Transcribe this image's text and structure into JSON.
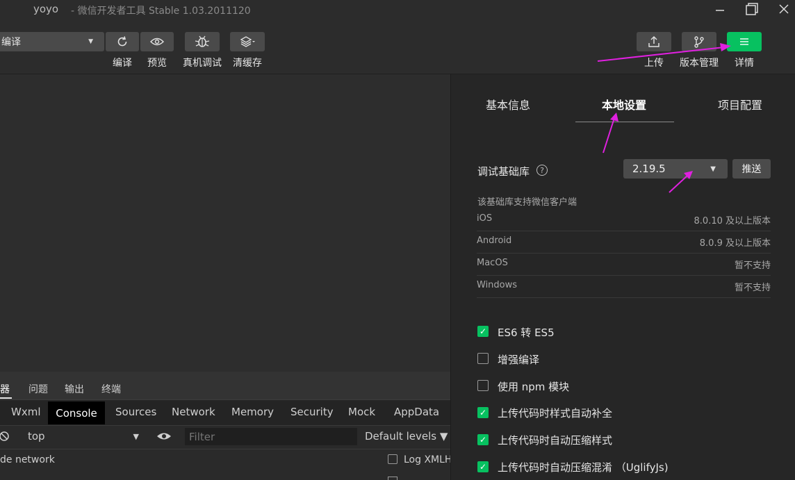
{
  "titlebar": {
    "project_name": "yoyo",
    "app_title": "- 微信开发者工具 Stable 1.03.2011120",
    "minimize_icon": "minimize-icon",
    "restore_icon": "restore-icon",
    "close_icon": "close-icon"
  },
  "toolbar": {
    "mode_value": "编译",
    "compile_label": "编译",
    "preview_label": "预览",
    "remote_debug_label": "真机调试",
    "clear_cache_label": "清缓存",
    "upload_label": "上传",
    "version_label": "版本管理",
    "details_label": "详情",
    "accent_color": "#07c160"
  },
  "devtools": {
    "top_tabs": [
      "器",
      "问题",
      "输出",
      "终端"
    ],
    "panel_tabs": [
      "Wxml",
      "Console",
      "Sources",
      "Network",
      "Memory",
      "Security",
      "Mock",
      "AppData"
    ],
    "context_value": "top",
    "filter_placeholder": "Filter",
    "levels_label": "Default levels ▼",
    "hide_network": "de network",
    "log_xmlh": "Log XMLH"
  },
  "panel": {
    "tabs": [
      "基本信息",
      "本地设置",
      "项目配置"
    ],
    "active_tab": "本地设置",
    "lib_label": "调试基础库",
    "lib_version": "2.19.5",
    "push_label": "推送",
    "support_title": "该基础库支持微信客户端",
    "support_rows": [
      {
        "os": "iOS",
        "version": "8.0.10 及以上版本"
      },
      {
        "os": "Android",
        "version": "8.0.9 及以上版本"
      },
      {
        "os": "MacOS",
        "version": "暂不支持"
      },
      {
        "os": "Windows",
        "version": "暂不支持"
      }
    ],
    "options": [
      {
        "label": "ES6 转 ES5",
        "checked": true
      },
      {
        "label": "增强编译",
        "checked": false
      },
      {
        "label": "使用 npm 模块",
        "checked": false
      },
      {
        "label": "上传代码时样式自动补全",
        "checked": true
      },
      {
        "label": "上传代码时自动压缩样式",
        "checked": true
      },
      {
        "label": "上传代码时自动压缩混淆 （UglifyJs)",
        "checked": true
      }
    ]
  },
  "annotation_color": "#e020e0"
}
